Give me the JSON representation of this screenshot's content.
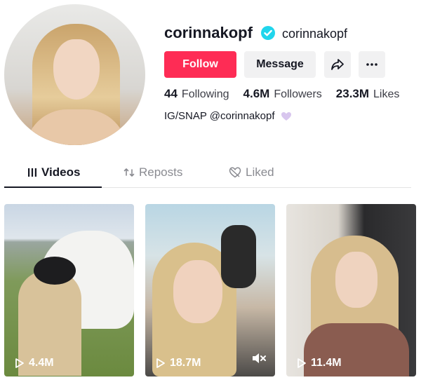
{
  "profile": {
    "username": "corinnakopf",
    "nickname": "corinnakopf",
    "verified": true,
    "bio": "IG/SNAP @corinnakopf",
    "bio_emoji": "purple-heart"
  },
  "actions": {
    "follow_label": "Follow",
    "message_label": "Message",
    "share_icon": "share-arrow-icon",
    "more_icon": "more-dots-icon"
  },
  "stats": [
    {
      "value": "44",
      "label": "Following"
    },
    {
      "value": "4.6M",
      "label": "Followers"
    },
    {
      "value": "23.3M",
      "label": "Likes"
    }
  ],
  "tabs": [
    {
      "label": "Videos",
      "icon": "grid-icon",
      "active": true
    },
    {
      "label": "Reposts",
      "icon": "repost-icon",
      "active": false
    },
    {
      "label": "Liked",
      "icon": "heart-outline-icon",
      "active": false
    }
  ],
  "videos": [
    {
      "views": "4.4M",
      "muted": false
    },
    {
      "views": "18.7M",
      "muted": true
    },
    {
      "views": "11.4M",
      "muted": false
    }
  ],
  "colors": {
    "accent": "#fe2c55",
    "verified": "#20d5ec",
    "button_bg": "#f1f1f2"
  }
}
